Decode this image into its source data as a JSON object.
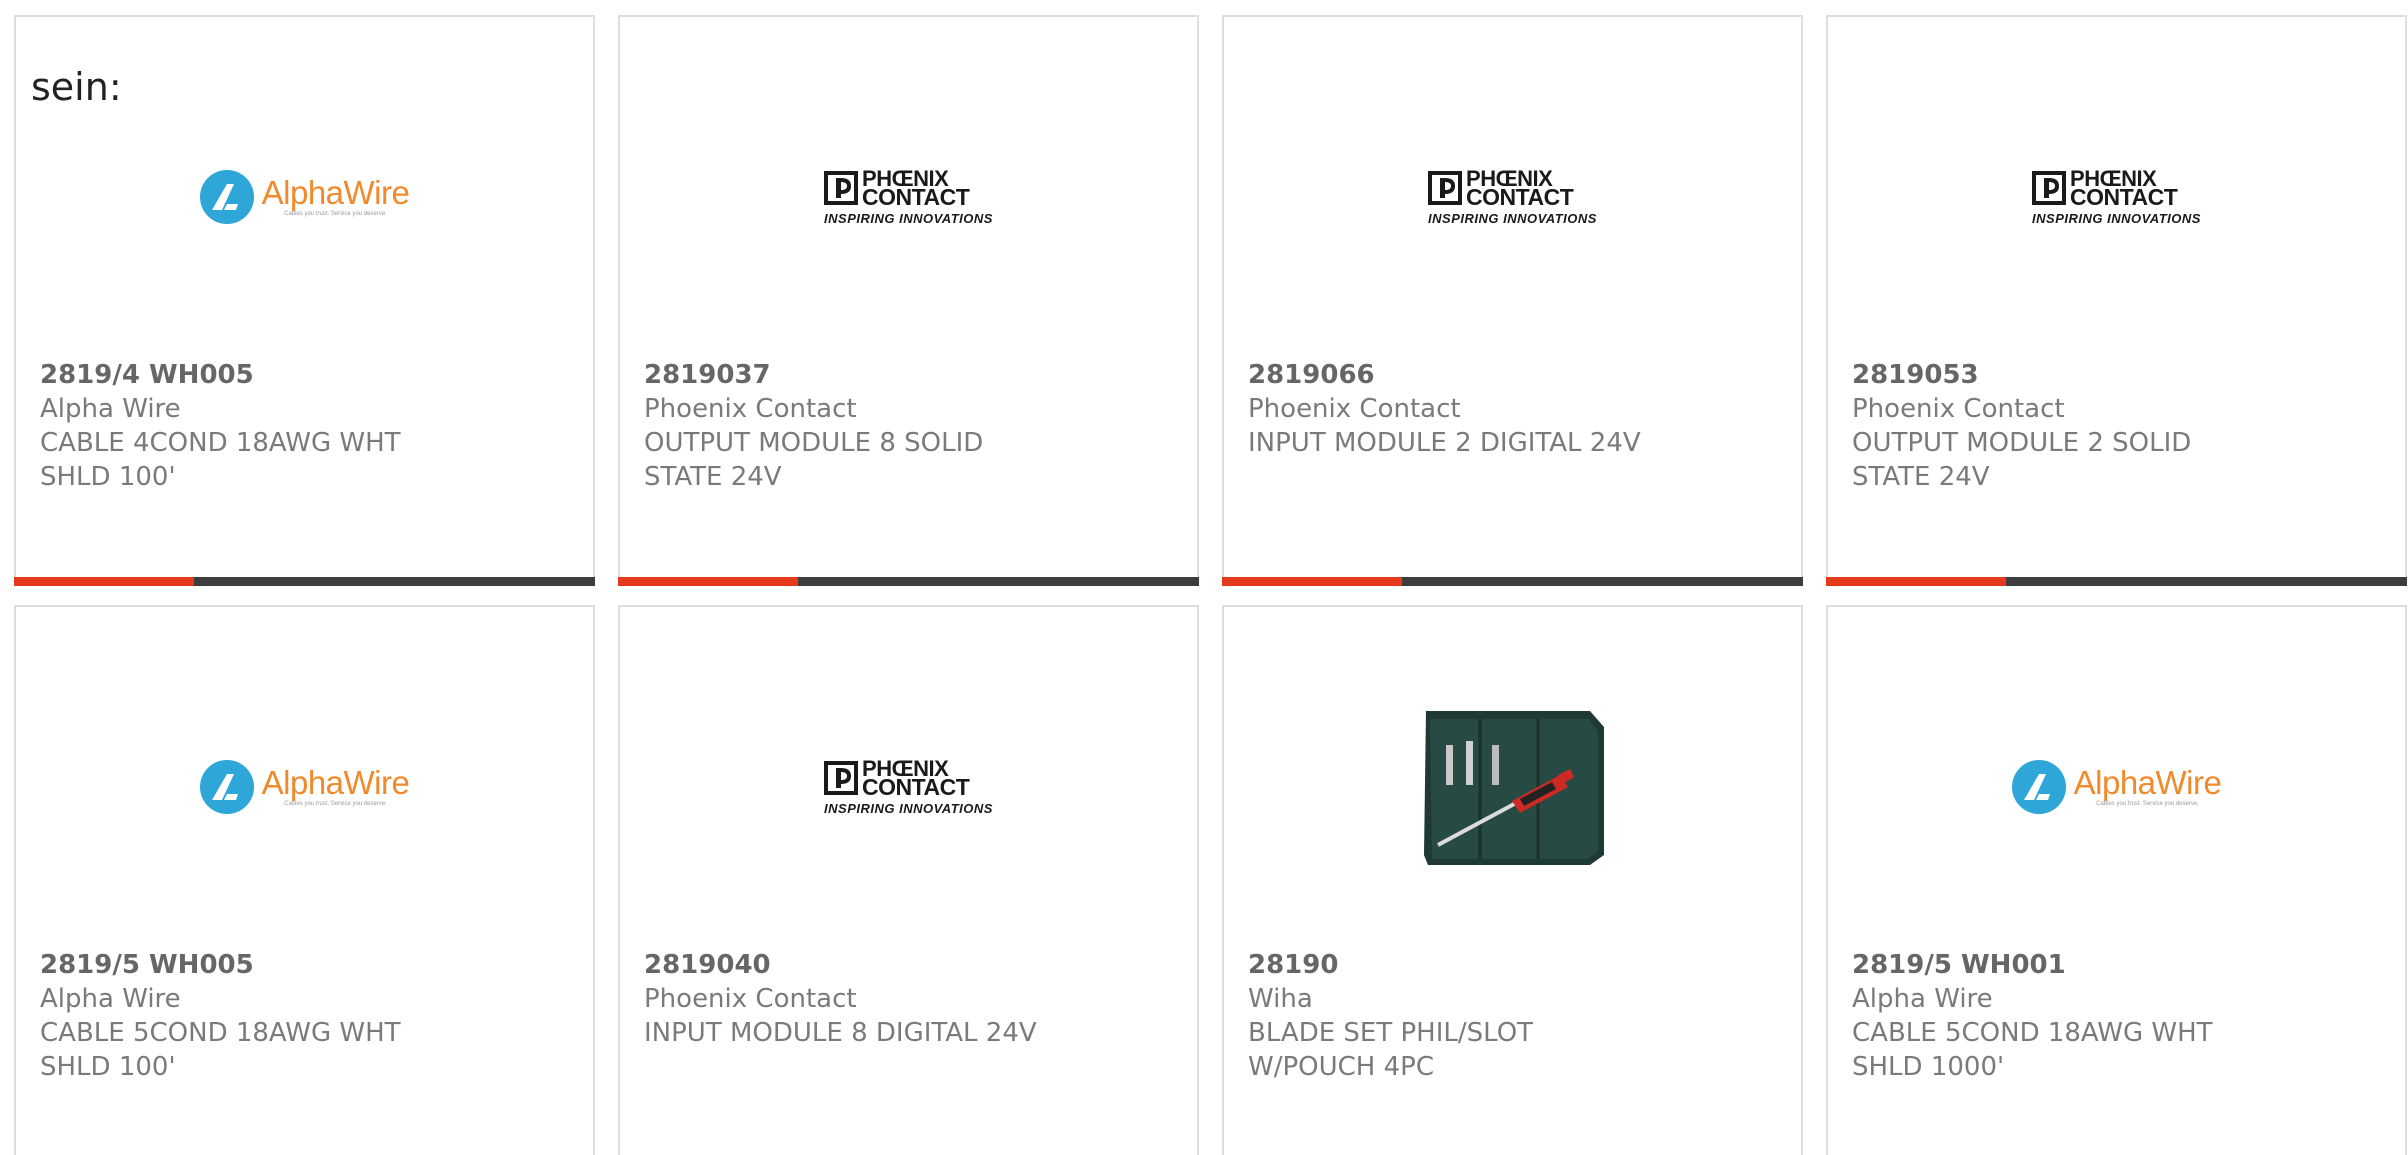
{
  "page_fragment": "sein:",
  "products": [
    {
      "part_number": "2819/4 WH005",
      "manufacturer": "Alpha Wire",
      "description": "CABLE 4COND 18AWG WHT SHLD 100'",
      "logo": {
        "type": "alphawire",
        "name": "AlphaWire",
        "tagline": "Cables you trust. Service you deserve."
      },
      "progress_fraction": 0.31
    },
    {
      "part_number": "2819037",
      "manufacturer": "Phoenix Contact",
      "description": "OUTPUT MODULE 8 SOLID STATE 24V",
      "logo": {
        "type": "phoenix",
        "line1": "PHŒNIX",
        "line2": "CONTACT",
        "tagline": "INSPIRING INNOVATIONS"
      },
      "progress_fraction": 0.31
    },
    {
      "part_number": "2819066",
      "manufacturer": "Phoenix Contact",
      "description": "INPUT MODULE 2 DIGITAL 24V",
      "logo": {
        "type": "phoenix",
        "line1": "PHŒNIX",
        "line2": "CONTACT",
        "tagline": "INSPIRING INNOVATIONS"
      },
      "progress_fraction": 0.31
    },
    {
      "part_number": "2819053",
      "manufacturer": "Phoenix Contact",
      "description": "OUTPUT MODULE 2 SOLID STATE 24V",
      "logo": {
        "type": "phoenix",
        "line1": "PHŒNIX",
        "line2": "CONTACT",
        "tagline": "INSPIRING INNOVATIONS"
      },
      "progress_fraction": 0.31
    },
    {
      "part_number": "2819/5 WH005",
      "manufacturer": "Alpha Wire",
      "description": "CABLE 5COND 18AWG WHT SHLD 100'",
      "logo": {
        "type": "alphawire",
        "name": "AlphaWire",
        "tagline": "Cables you trust. Service you deserve."
      }
    },
    {
      "part_number": "2819040",
      "manufacturer": "Phoenix Contact",
      "description": "INPUT MODULE 8 DIGITAL 24V",
      "logo": {
        "type": "phoenix",
        "line1": "PHŒNIX",
        "line2": "CONTACT",
        "tagline": "INSPIRING INNOVATIONS"
      }
    },
    {
      "part_number": "28190",
      "manufacturer": "Wiha",
      "description": "BLADE SET PHIL/SLOT W/POUCH 4PC",
      "logo": {
        "type": "photo",
        "icon": "screwdriver-set-pouch-icon"
      }
    },
    {
      "part_number": "2819/5 WH001",
      "manufacturer": "Alpha Wire",
      "description": "CABLE 5COND 18AWG WHT SHLD 1000'",
      "logo": {
        "type": "alphawire",
        "name": "AlphaWire",
        "tagline": "Cables you trust. Service you deserve."
      }
    }
  ],
  "colors": {
    "accent": "#e5391e",
    "bar_track": "#3d3d3d",
    "card_border": "#dedede",
    "text": "#777777",
    "alphawire_orange": "#f08a2c",
    "alphawire_blue": "#2ea6d8"
  }
}
